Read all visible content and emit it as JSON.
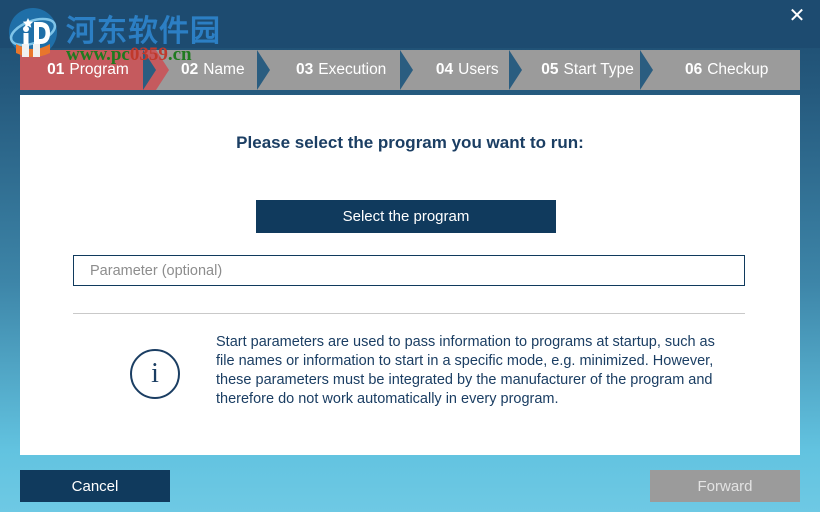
{
  "window": {
    "close_label": "✕",
    "accent_active_color": "#c55a5e",
    "accent_dark_color": "#103a5d",
    "tab_inactive_color": "#9b9b9b",
    "background_top_color": "#1c4a6e",
    "background_bottom_color": "#6ec9e4"
  },
  "watermark": {
    "site_name": "河东软件园",
    "url_prefix": "www.pc",
    "url_mid": "0359",
    "url_suffix": ".cn",
    "logo_text": "iD"
  },
  "steps": [
    {
      "num": "01",
      "label": "Program",
      "active": true
    },
    {
      "num": "02",
      "label": "Name",
      "active": false
    },
    {
      "num": "03",
      "label": "Execution",
      "active": false
    },
    {
      "num": "04",
      "label": "Users",
      "active": false
    },
    {
      "num": "05",
      "label": "Start Type",
      "active": false
    },
    {
      "num": "06",
      "label": "Checkup",
      "active": false
    }
  ],
  "main": {
    "prompt_title": "Please select the program you want to run:",
    "select_program_label": "Select the program",
    "parameter_value": "",
    "parameter_placeholder": "Parameter (optional)",
    "info_icon_glyph": "i",
    "info_text": "Start parameters are used to pass information to programs at startup, such as file names or information to start in a specific mode, e.g. minimized. However, these parameters must be integrated by the manufacturer of the program and therefore do not work automatically in every program."
  },
  "footer": {
    "cancel_label": "Cancel",
    "forward_label": "Forward"
  }
}
